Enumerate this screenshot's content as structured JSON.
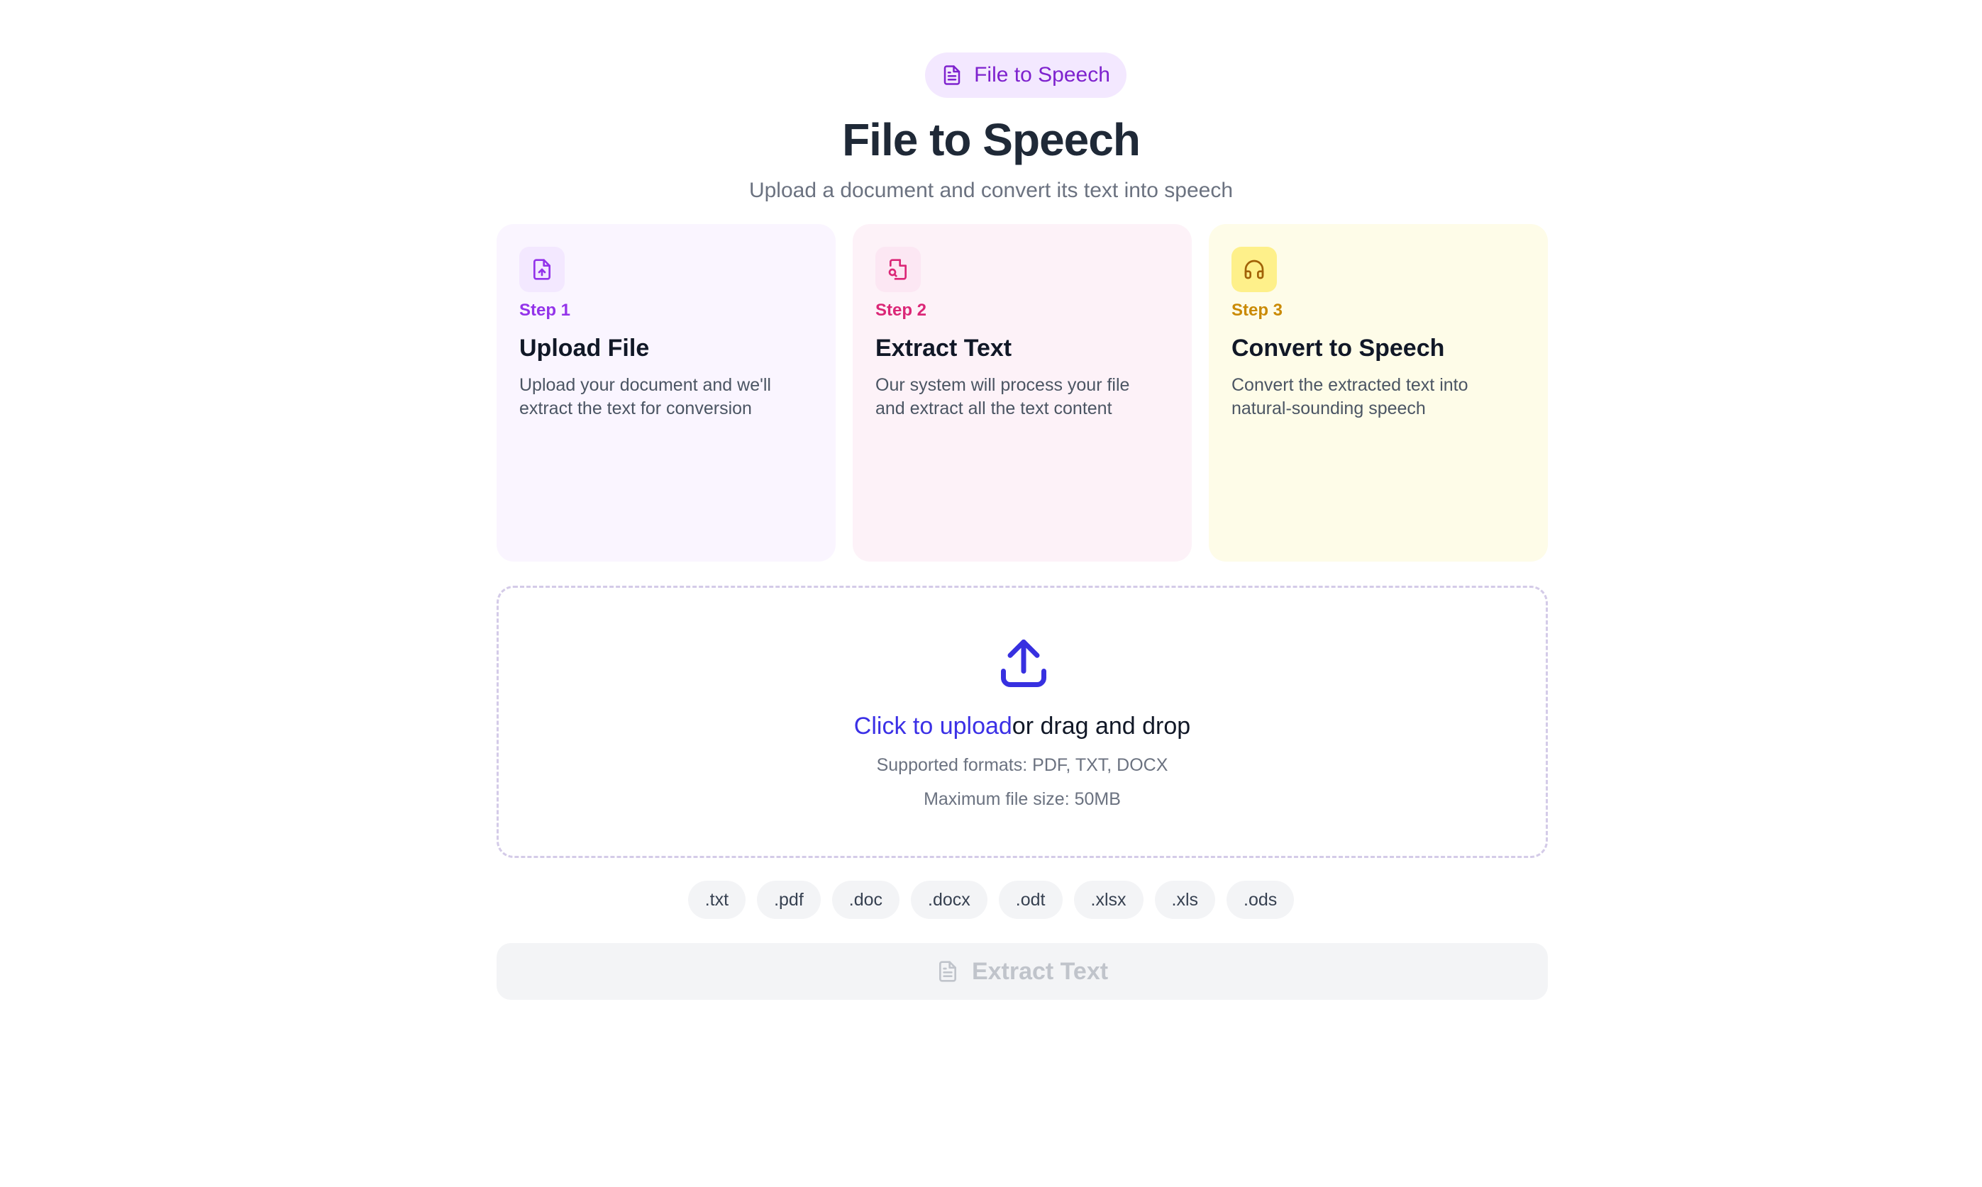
{
  "header": {
    "badge_label": "File to Speech",
    "title": "File to Speech",
    "subtitle": "Upload a document and convert its text into speech"
  },
  "steps": [
    {
      "icon": "file-upload-icon",
      "step_label": "Step 1",
      "title": "Upload File",
      "description": "Upload your document and we'll extract the text for conversion",
      "accent": "#9333ea"
    },
    {
      "icon": "file-search-icon",
      "step_label": "Step 2",
      "title": "Extract Text",
      "description": "Our system will process your file and extract all the text content",
      "accent": "#db2777"
    },
    {
      "icon": "headphones-icon",
      "step_label": "Step 3",
      "title": "Convert to Speech",
      "description": "Convert the extracted text into natural-sounding speech",
      "accent": "#ca8a04"
    }
  ],
  "dropzone": {
    "icon": "upload-icon",
    "link_text": "Click to upload",
    "rest_text": "or drag and drop",
    "formats": "Supported formats: PDF, TXT, DOCX",
    "max_size": "Maximum file size: 50MB"
  },
  "extensions": [
    ".txt",
    ".pdf",
    ".doc",
    ".docx",
    ".odt",
    ".xlsx",
    ".xls",
    ".ods"
  ],
  "extract_button": {
    "label": "Extract Text",
    "icon": "file-text-icon",
    "disabled": true
  }
}
